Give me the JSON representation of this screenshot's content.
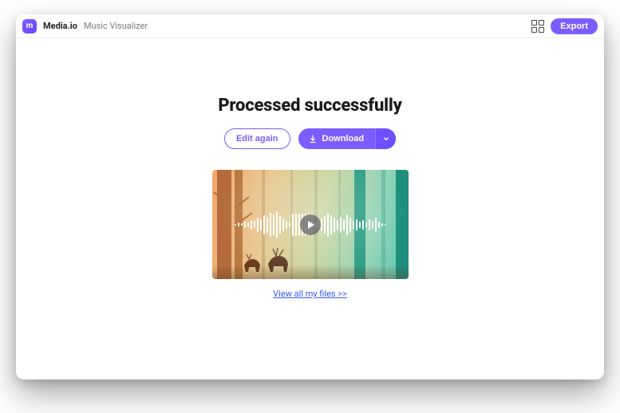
{
  "header": {
    "brand": "Media.io",
    "subtitle": "Music Visualizer",
    "export_label": "Export",
    "logo_glyph": "m"
  },
  "main": {
    "heading": "Processed successfully",
    "edit_label": "Edit again",
    "download_label": "Download",
    "files_link": "View all my files >>"
  },
  "icons": {
    "qr": "qr-icon",
    "download": "download-icon",
    "caret": "chevron-down-icon",
    "play": "play-icon"
  },
  "colors": {
    "accent": "#7c5cff",
    "link": "#3359ff"
  }
}
